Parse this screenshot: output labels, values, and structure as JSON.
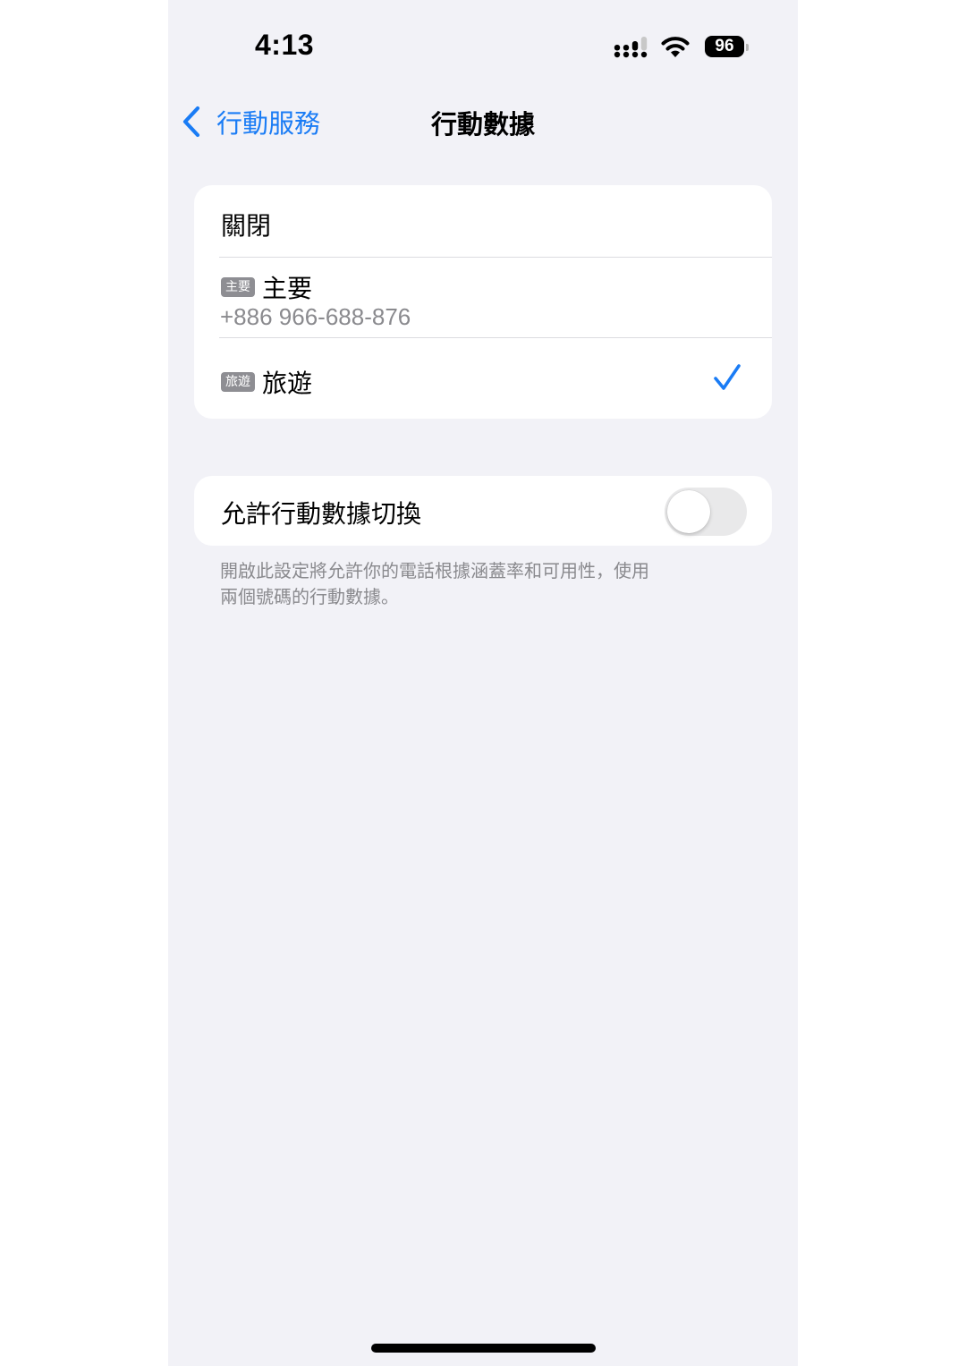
{
  "status_bar": {
    "time": "4:13",
    "battery": "96"
  },
  "nav": {
    "back_label": "行動服務",
    "title": "行動數據"
  },
  "data_lines": {
    "off_label": "關閉",
    "primary": {
      "badge": "主要",
      "label": "主要",
      "number": "+886 966-688-876"
    },
    "travel": {
      "badge": "旅遊",
      "label": "旅遊",
      "selected": true
    }
  },
  "switching": {
    "label": "允許行動數據切換",
    "enabled": false,
    "footnote_line1": "開啟此設定將允許你的電話根據涵蓋率和可用性，使用",
    "footnote_line2": "兩個號碼的行動數據。"
  },
  "colors": {
    "accent": "#1a7cf5",
    "background": "#f2f2f7",
    "badge": "#8e8e93"
  },
  "icons": {
    "back": "chevron-left-icon",
    "selected": "checkmark-icon",
    "signal": "cellular-signal-icon",
    "wifi": "wifi-icon",
    "battery": "battery-icon"
  }
}
